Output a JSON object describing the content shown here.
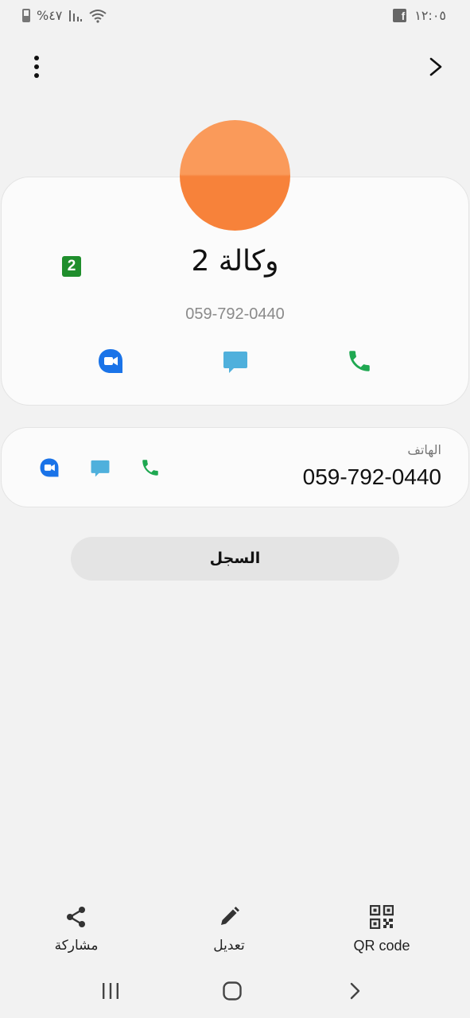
{
  "status_bar": {
    "battery_text": "%٤٧",
    "time": "١٢:٠٥"
  },
  "contact": {
    "name": "وكالة 2",
    "number": "059-792-0440",
    "sim_badge": "2",
    "avatar_color": "#f7823a"
  },
  "phone_section": {
    "label": "الهاتف",
    "value": "059-792-0440"
  },
  "history_button": "السجل",
  "bottom_actions": {
    "share": "مشاركة",
    "edit": "تعديل",
    "qr": "QR code"
  },
  "icons": {
    "video": "video-call-icon",
    "message": "message-icon",
    "call": "phone-icon"
  },
  "colors": {
    "video": "#1a73e8",
    "message": "#4fb0dc",
    "call": "#1fa851",
    "sim": "#1f8e2c"
  }
}
